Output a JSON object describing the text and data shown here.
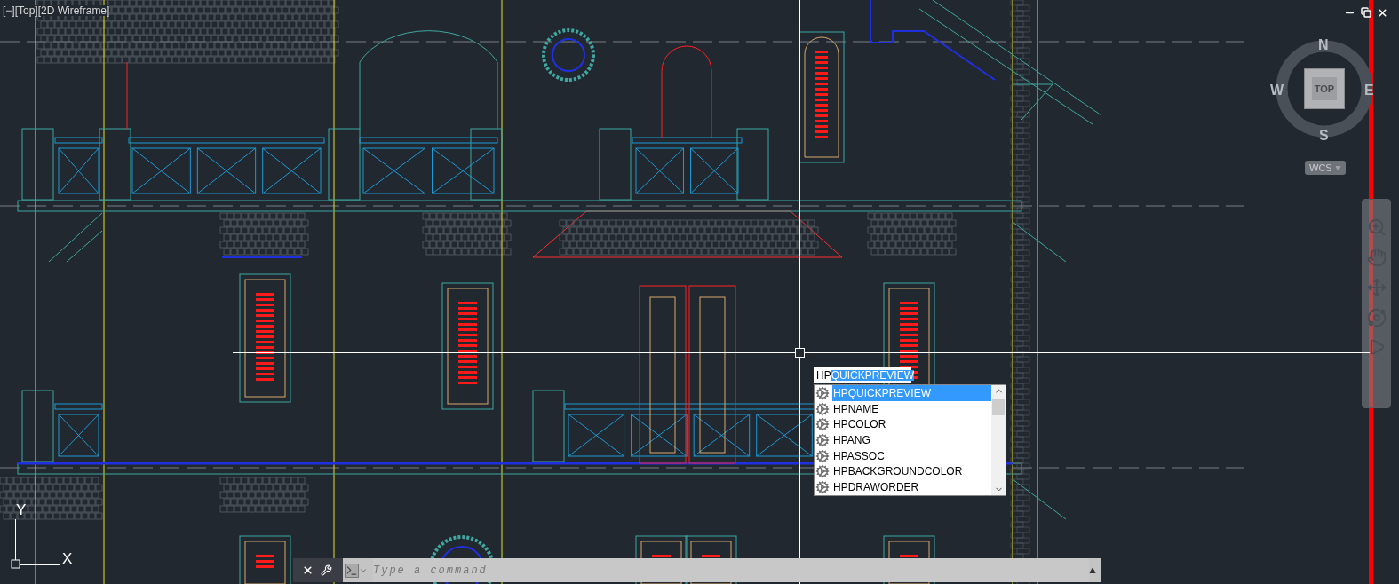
{
  "viewport": {
    "controls": [
      {
        "label": "[−]"
      },
      {
        "label": "[Top]"
      },
      {
        "label": "[2D Wireframe]"
      }
    ]
  },
  "view_cube": {
    "north": "N",
    "south": "S",
    "east": "E",
    "west": "W",
    "face": "TOP"
  },
  "coordinate_menu": {
    "label": "WCS"
  },
  "ucs_icon": {
    "x_axis": "X",
    "y_axis": "Y"
  },
  "command_input": {
    "typed": "HP",
    "completion": "QUICKPREVIEW"
  },
  "suggestions": [
    {
      "label": "HPQUICKPREVIEW",
      "selected": true
    },
    {
      "label": "HPNAME",
      "selected": false
    },
    {
      "label": "HPCOLOR",
      "selected": false
    },
    {
      "label": "HPANG",
      "selected": false
    },
    {
      "label": "HPASSOC",
      "selected": false
    },
    {
      "label": "HPBACKGROUNDCOLOR",
      "selected": false
    },
    {
      "label": "HPDRAWORDER",
      "selected": false
    }
  ],
  "command_line": {
    "placeholder": "Type a command"
  }
}
